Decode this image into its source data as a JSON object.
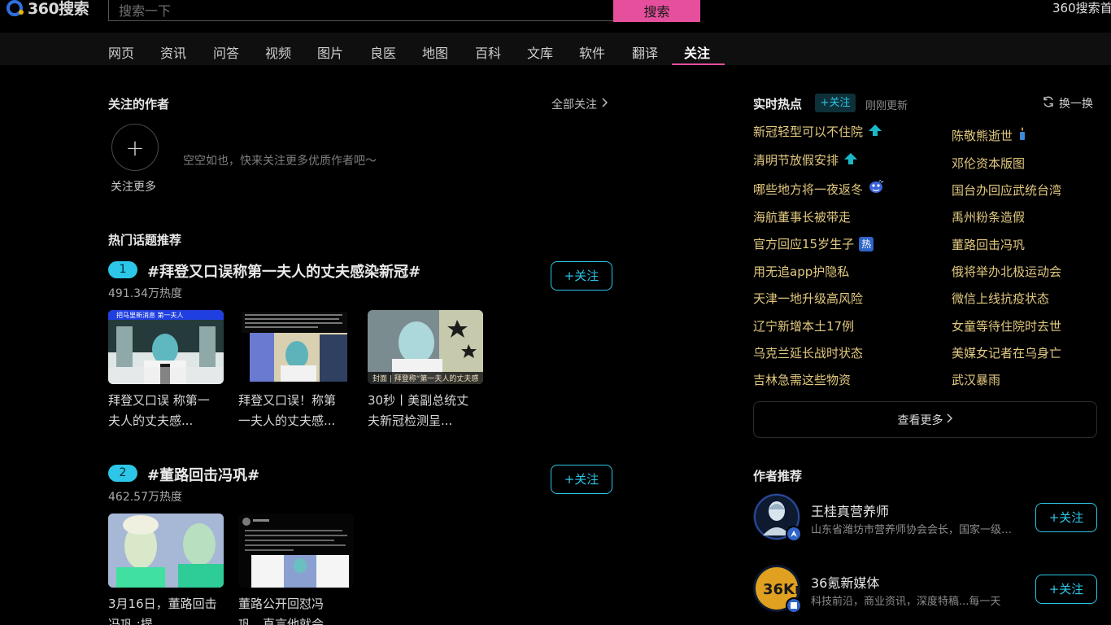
{
  "header": {
    "logo_text": "360搜索",
    "search_placeholder": "搜索一下",
    "search_button": "搜索",
    "home_link": "360搜索首"
  },
  "nav": {
    "items": [
      "网页",
      "资讯",
      "问答",
      "视频",
      "图片",
      "良医",
      "地图",
      "百科",
      "文库",
      "软件",
      "翻译",
      "关注"
    ],
    "active": "关注"
  },
  "followed_authors": {
    "title": "关注的作者",
    "all_follow": "全部关注",
    "add_more": "关注更多",
    "empty_tip": "空空如也，快来关注更多优质作者吧～"
  },
  "hot_topics": {
    "title": "热门话题推荐",
    "follow_label": "+关注",
    "topics": [
      {
        "rank": "1",
        "title": "#拜登又口误称第一夫人的丈夫感染新冠#",
        "heat": "491.34万热度",
        "thumb_text": [
          "把马里新消息 第一夫人",
          "",
          "封面 | 拜登称“第一夫人的丈夫感"
        ],
        "captions": [
          [
            "拜登又口误 称第一",
            "夫人的丈夫感..."
          ],
          [
            "拜登又口误！称第",
            "一夫人的丈夫感..."
          ],
          [
            "30秒丨美副总统丈",
            "夫新冠检测呈..."
          ]
        ]
      },
      {
        "rank": "2",
        "title": "#董路回击冯巩#",
        "heat": "462.57万热度",
        "captions": [
          [
            "3月16日，董路回击",
            "冯巩 :提..."
          ],
          [
            "董路公开回怼冯",
            "巩，直言他就会..."
          ]
        ]
      }
    ]
  },
  "realtime_hot": {
    "title": "实时热点",
    "follow_tag": "+关注",
    "updated": "刚刚更新",
    "refresh": "换一换",
    "left": [
      {
        "text": "新冠轻型可以不住院",
        "tag": "up"
      },
      {
        "text": "清明节放假安排",
        "tag": "up"
      },
      {
        "text": "哪些地方将一夜返冬",
        "tag": "cold"
      },
      {
        "text": "海航董事长被带走",
        "tag": ""
      },
      {
        "text": "官方回应15岁生子",
        "tag": "hot"
      },
      {
        "text": "用无追app护隐私",
        "tag": ""
      },
      {
        "text": "天津一地升级高风险",
        "tag": ""
      },
      {
        "text": "辽宁新增本土17例",
        "tag": ""
      },
      {
        "text": "乌克兰延长战时状态",
        "tag": ""
      },
      {
        "text": "吉林急需这些物资",
        "tag": ""
      }
    ],
    "right": [
      {
        "text": "陈敬熊逝世",
        "tag": "candle"
      },
      {
        "text": "邓伦资本版图",
        "tag": ""
      },
      {
        "text": "国台办回应武统台湾",
        "tag": ""
      },
      {
        "text": "禹州粉条造假",
        "tag": ""
      },
      {
        "text": "董路回击冯巩",
        "tag": ""
      },
      {
        "text": "俄将举办北极运动会",
        "tag": ""
      },
      {
        "text": "微信上线抗疫状态",
        "tag": ""
      },
      {
        "text": "女童等待住院时去世",
        "tag": ""
      },
      {
        "text": "美媒女记者在乌身亡",
        "tag": ""
      },
      {
        "text": "武汉暴雨",
        "tag": ""
      }
    ],
    "more": "查看更多",
    "hot_tag_text": "热"
  },
  "author_recommend": {
    "title": "作者推荐",
    "follow_label": "+关注",
    "authors": [
      {
        "name": "王桂真营养师",
        "desc": "山东省潍坊市营养师协会会长，国家一级营养师",
        "avatar_text": ""
      },
      {
        "name": "36氪新媒体",
        "desc": "科技前沿，商业资讯，深度特稿...每一天",
        "avatar_text": "36Kr"
      }
    ]
  },
  "colors": {
    "accent_pink": "#e64f9b",
    "accent_cyan": "#2cc6e8",
    "hot_text": "#e2c97f",
    "background": "#000000"
  }
}
